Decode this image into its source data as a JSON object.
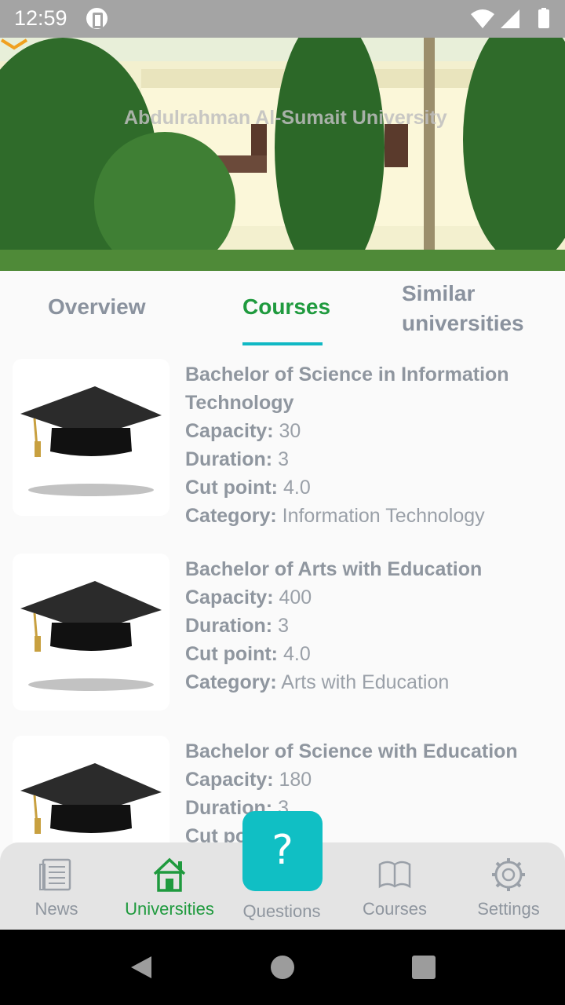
{
  "status_bar": {
    "time": "12:59"
  },
  "header": {
    "title": "Abdulrahman Al-Sumait University"
  },
  "tabs": [
    {
      "label": "Overview"
    },
    {
      "label": "Courses"
    },
    {
      "label": "Similar universities"
    }
  ],
  "courses": [
    {
      "title": "Bachelor of Science in Information Technology",
      "capacity": "30",
      "duration": "3",
      "cut_point": "4.0",
      "category": "Information Technology"
    },
    {
      "title": "Bachelor of Arts with Education",
      "capacity": "400",
      "duration": "3",
      "cut_point": "4.0",
      "category": "Arts with Education"
    },
    {
      "title": "Bachelor of Science with Education",
      "capacity": "180",
      "duration": "3",
      "cut_point": "",
      "category": ""
    }
  ],
  "field_labels": {
    "capacity": "Capacity:",
    "duration": "Duration:",
    "cut_point": "Cut point:",
    "category": "Category:"
  },
  "fab": {
    "label": "?"
  },
  "bottom_nav": {
    "news": "News",
    "universities": "Universities",
    "questions": "Questions",
    "courses": "Courses",
    "settings": "Settings"
  },
  "colors": {
    "accent_green": "#1f9a3e",
    "accent_teal": "#10bfc4",
    "muted_text": "#8f969f"
  }
}
